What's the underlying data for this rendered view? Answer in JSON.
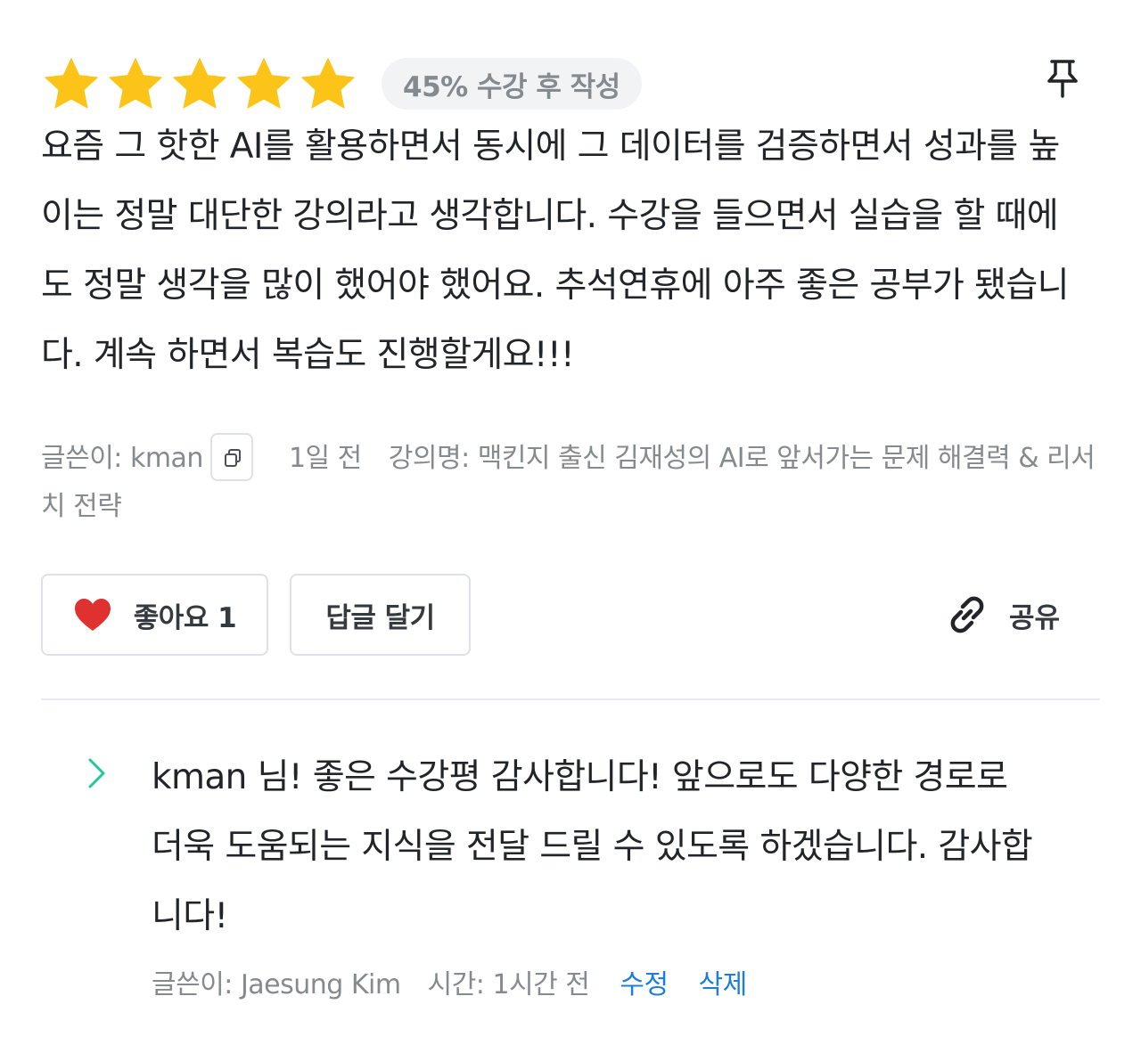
{
  "review": {
    "rating": 5,
    "rating_max": 5,
    "star_color": "#fcc419",
    "progress_badge": "45% 수강 후 작성",
    "pin_icon": "pin-icon",
    "body": "요즘 그 핫한 AI를 활용하면서 동시에 그 데이터를 검증하면서 성과를 높이는 정말 대단한 강의라고 생각합니다. 수강을 들으면서 실습을 할 때에도 정말 생각을 많이 했어야 했어요. 추석연휴에 아주 좋은 공부가 됐습니다. 계속 하면서 복습도 진행할게요!!!",
    "meta": {
      "author_label": "글쓴이: kman",
      "copy_icon": "copy-icon",
      "time": "1일 전",
      "course_label": "강의명: 맥킨지 출신 김재성의 AI로 앞서가는 문제 해결력 & 리서치 전략"
    },
    "actions": {
      "like_label": "좋아요 1",
      "like_icon": "heart-icon",
      "like_color": "#e03131",
      "reply_label": "답글 달기",
      "share_label": "공유",
      "share_icon": "link-icon"
    }
  },
  "reply": {
    "expand_icon": "chevron-right-icon",
    "accent_color": "#20c997",
    "body": "kman 님! 좋은 수강평 감사합니다! 앞으로도 다양한 경로로 더욱 도움되는 지식을 전달 드릴 수 있도록 하겠습니다. 감사합니다!",
    "author_label": "글쓴이: Jaesung Kim",
    "time_label": "시간: 1시간 전",
    "edit_label": "수정",
    "delete_label": "삭제",
    "link_color": "#1c7ed6"
  }
}
